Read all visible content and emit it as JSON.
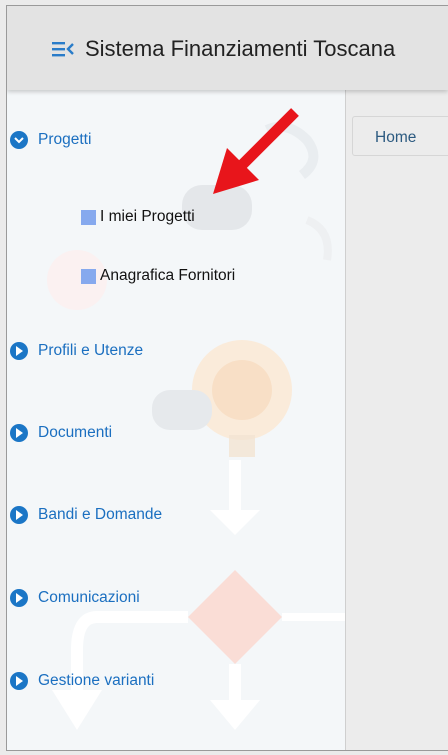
{
  "header": {
    "title": "Sistema Finanziamenti Toscana",
    "menu_icon": "menu-collapse-icon"
  },
  "breadcrumb": {
    "home": "Home"
  },
  "sidebar": {
    "sections": [
      {
        "label": "Progetti",
        "expanded": true
      },
      {
        "label": "Profili e Utenze",
        "expanded": false
      },
      {
        "label": "Documenti",
        "expanded": false
      },
      {
        "label": "Bandi e Domande",
        "expanded": false
      },
      {
        "label": "Comunicazioni",
        "expanded": false
      },
      {
        "label": "Gestione varianti",
        "expanded": false
      }
    ],
    "subitems": [
      {
        "label": "I miei Progetti"
      },
      {
        "label": "Anagrafica Fornitori"
      }
    ]
  },
  "colors": {
    "accent": "#1b76c6",
    "annotation_arrow": "#e8151b",
    "subitem_bullet": "#86a9ee"
  }
}
